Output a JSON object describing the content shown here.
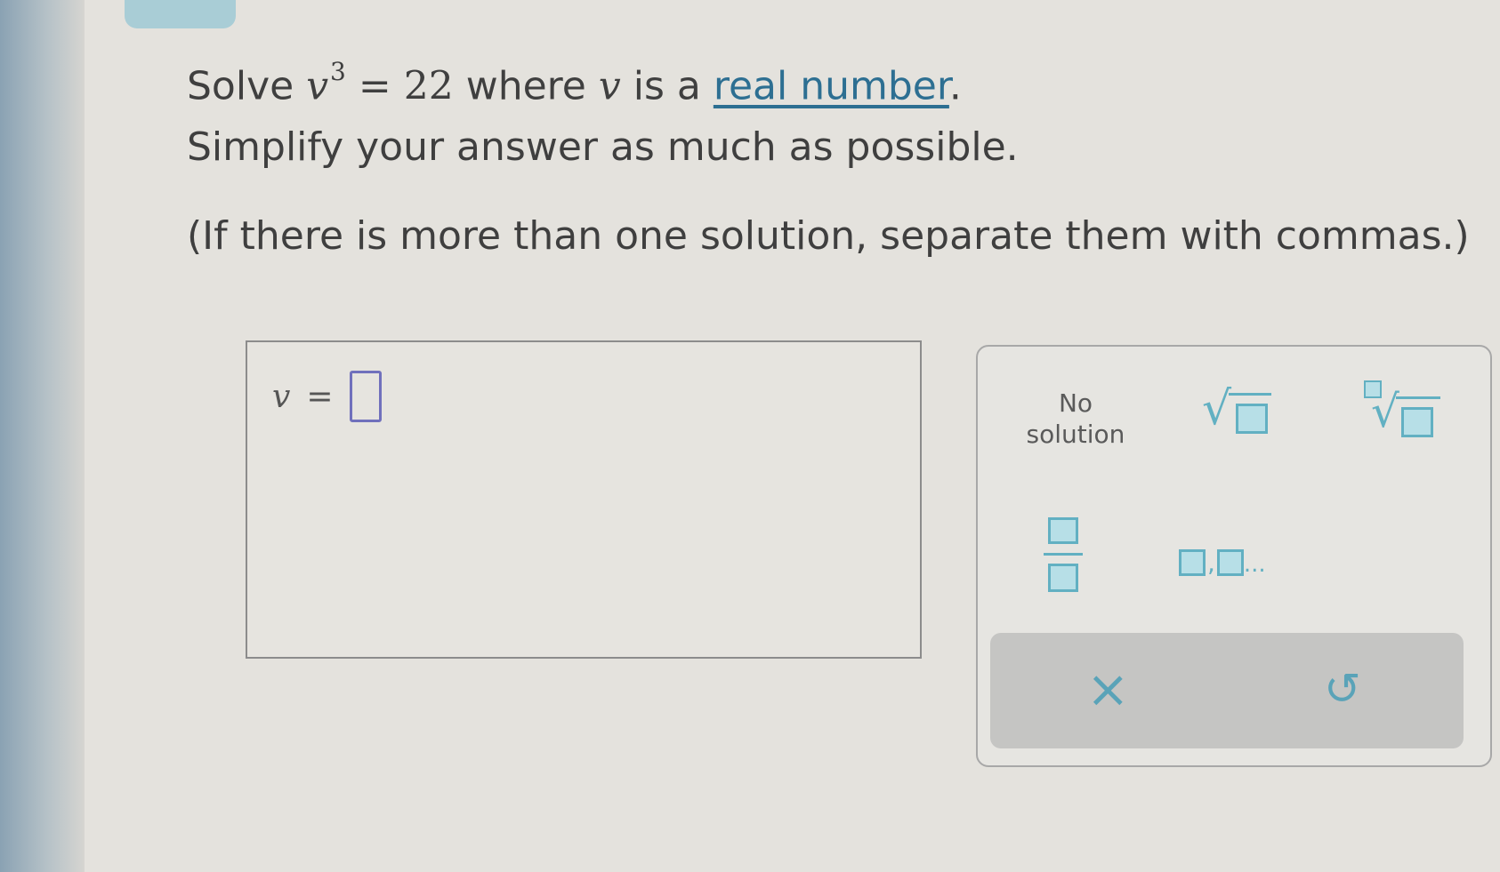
{
  "question": {
    "solve_word": "Solve",
    "equation_var": "v",
    "equation_exp": "3",
    "equation_rhs": "= 22",
    "where_word": "where",
    "var_ref": "v",
    "is_a": "is a",
    "link_text": "real number",
    "link_period": ".",
    "simplify_text": "Simplify your answer as much as possible.",
    "multi_solution_note": "(If there is more than one solution, separate them with commas.)"
  },
  "answer": {
    "variable": "v",
    "equals": "=",
    "value": ""
  },
  "keypad": {
    "no_solution_line1": "No",
    "no_solution_line2": "solution",
    "list_separator": ",",
    "list_ellipsis": "...",
    "clear_symbol": "×",
    "undo_symbol": "↺",
    "accent_color": "#62b0c2",
    "icons": [
      "sqrt-icon",
      "nth-root-icon",
      "fraction-icon",
      "list-icon",
      "clear-icon",
      "undo-icon"
    ]
  },
  "colors": {
    "link": "#2d6f92",
    "input_border": "#7070bc",
    "text": "#3f3f3f"
  }
}
